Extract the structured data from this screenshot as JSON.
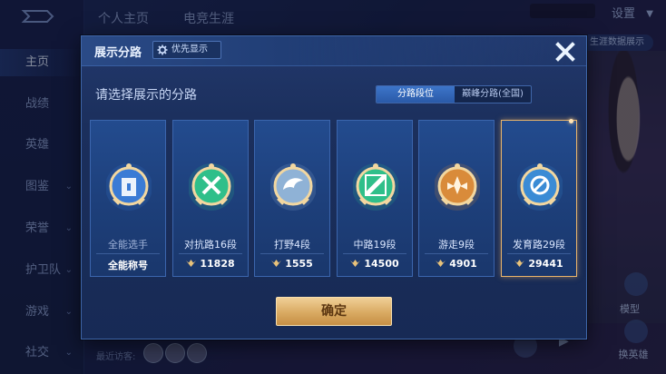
{
  "background": {
    "nav_tabs": [
      "个人主页",
      "电竞生涯"
    ],
    "settings_label": "设置",
    "data_button_label": "生涯数据展示",
    "sidebar_items": [
      {
        "label": "主页",
        "active": true,
        "has_chevron": false
      },
      {
        "label": "战绩",
        "active": false,
        "has_chevron": false
      },
      {
        "label": "英雄",
        "active": false,
        "has_chevron": false
      },
      {
        "label": "图鉴",
        "active": false,
        "has_chevron": true
      },
      {
        "label": "荣誉",
        "active": false,
        "has_chevron": true
      },
      {
        "label": "护卫队",
        "active": false,
        "has_chevron": true
      },
      {
        "label": "游戏",
        "active": false,
        "has_chevron": true
      },
      {
        "label": "社交",
        "active": false,
        "has_chevron": true
      }
    ],
    "recent_visitors_label": "最近访客:",
    "hero_labels": [
      "模型",
      "换英雄"
    ]
  },
  "dialog": {
    "title": "展示分路",
    "priority_label": "优先显示",
    "prompt": "请选择展示的分路",
    "segment": {
      "left": "分路段位",
      "right": "巅峰分路(全国)",
      "active": "left"
    },
    "cards": [
      {
        "name": "全能选手",
        "value": "全能称号",
        "has_mark": false,
        "emblem": "allround-emblem-icon",
        "color": "#3a7bd5",
        "selected": false,
        "dim_name": true
      },
      {
        "name": "对抗路16段",
        "value": "11828",
        "has_mark": true,
        "emblem": "clash-lane-emblem-icon",
        "color": "#2fbf8a",
        "selected": false,
        "dim_name": false
      },
      {
        "name": "打野4段",
        "value": "1555",
        "has_mark": true,
        "emblem": "jungle-emblem-icon",
        "color": "#8fb2d6",
        "selected": false,
        "dim_name": false
      },
      {
        "name": "中路19段",
        "value": "14500",
        "has_mark": true,
        "emblem": "mid-lane-emblem-icon",
        "color": "#2fbf8a",
        "selected": false,
        "dim_name": false
      },
      {
        "name": "游走9段",
        "value": "4901",
        "has_mark": true,
        "emblem": "roam-emblem-icon",
        "color": "#d98b3a",
        "selected": false,
        "dim_name": false
      },
      {
        "name": "发育路29段",
        "value": "29441",
        "has_mark": true,
        "emblem": "farm-lane-emblem-icon",
        "color": "#3a8bd5",
        "selected": true,
        "dim_name": false
      }
    ],
    "confirm_label": "确定",
    "accent_gold": "#d9aa62"
  }
}
